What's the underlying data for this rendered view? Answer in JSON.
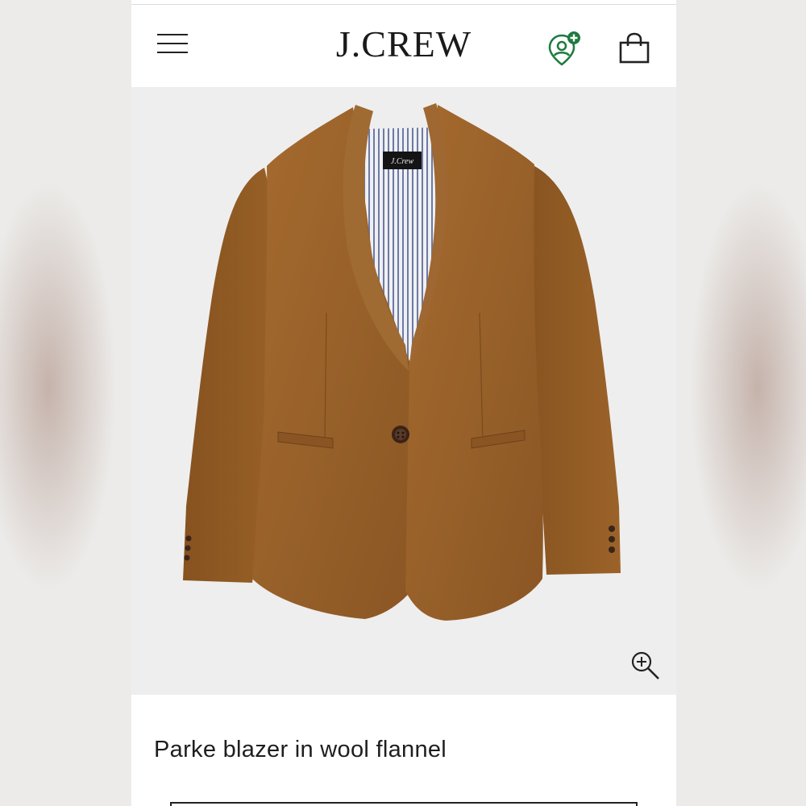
{
  "header": {
    "logo_text": "J.CREW",
    "icons": [
      "menu-icon",
      "store-locator-icon",
      "shopping-bag-icon"
    ],
    "accent_color": "#1f7a3f"
  },
  "product": {
    "image_label": "J.Crew",
    "title": "Parke blazer in wool flannel",
    "blazer_color": "#9a6228"
  },
  "image_controls": {
    "zoom_icon": "zoom-in-icon"
  }
}
